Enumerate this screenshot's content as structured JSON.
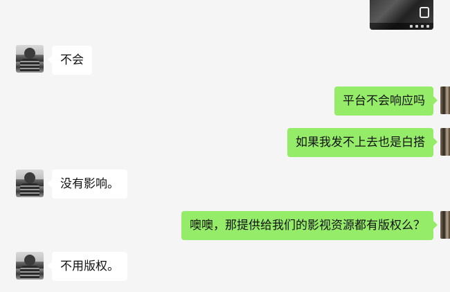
{
  "messages": [
    {
      "side": "left",
      "text": "不会"
    },
    {
      "side": "right",
      "text": "平台不会响应吗"
    },
    {
      "side": "right",
      "text": "如果我发不上去也是白搭"
    },
    {
      "side": "left",
      "text": "没有影响。"
    },
    {
      "side": "right",
      "text": "噢噢，那提供给我们的影视资源都有版权么？"
    },
    {
      "side": "left",
      "text": "不用版权。"
    }
  ],
  "colors": {
    "background": "#f5f5f5",
    "incoming_bubble": "#ffffff",
    "outgoing_bubble": "#95ec69"
  }
}
